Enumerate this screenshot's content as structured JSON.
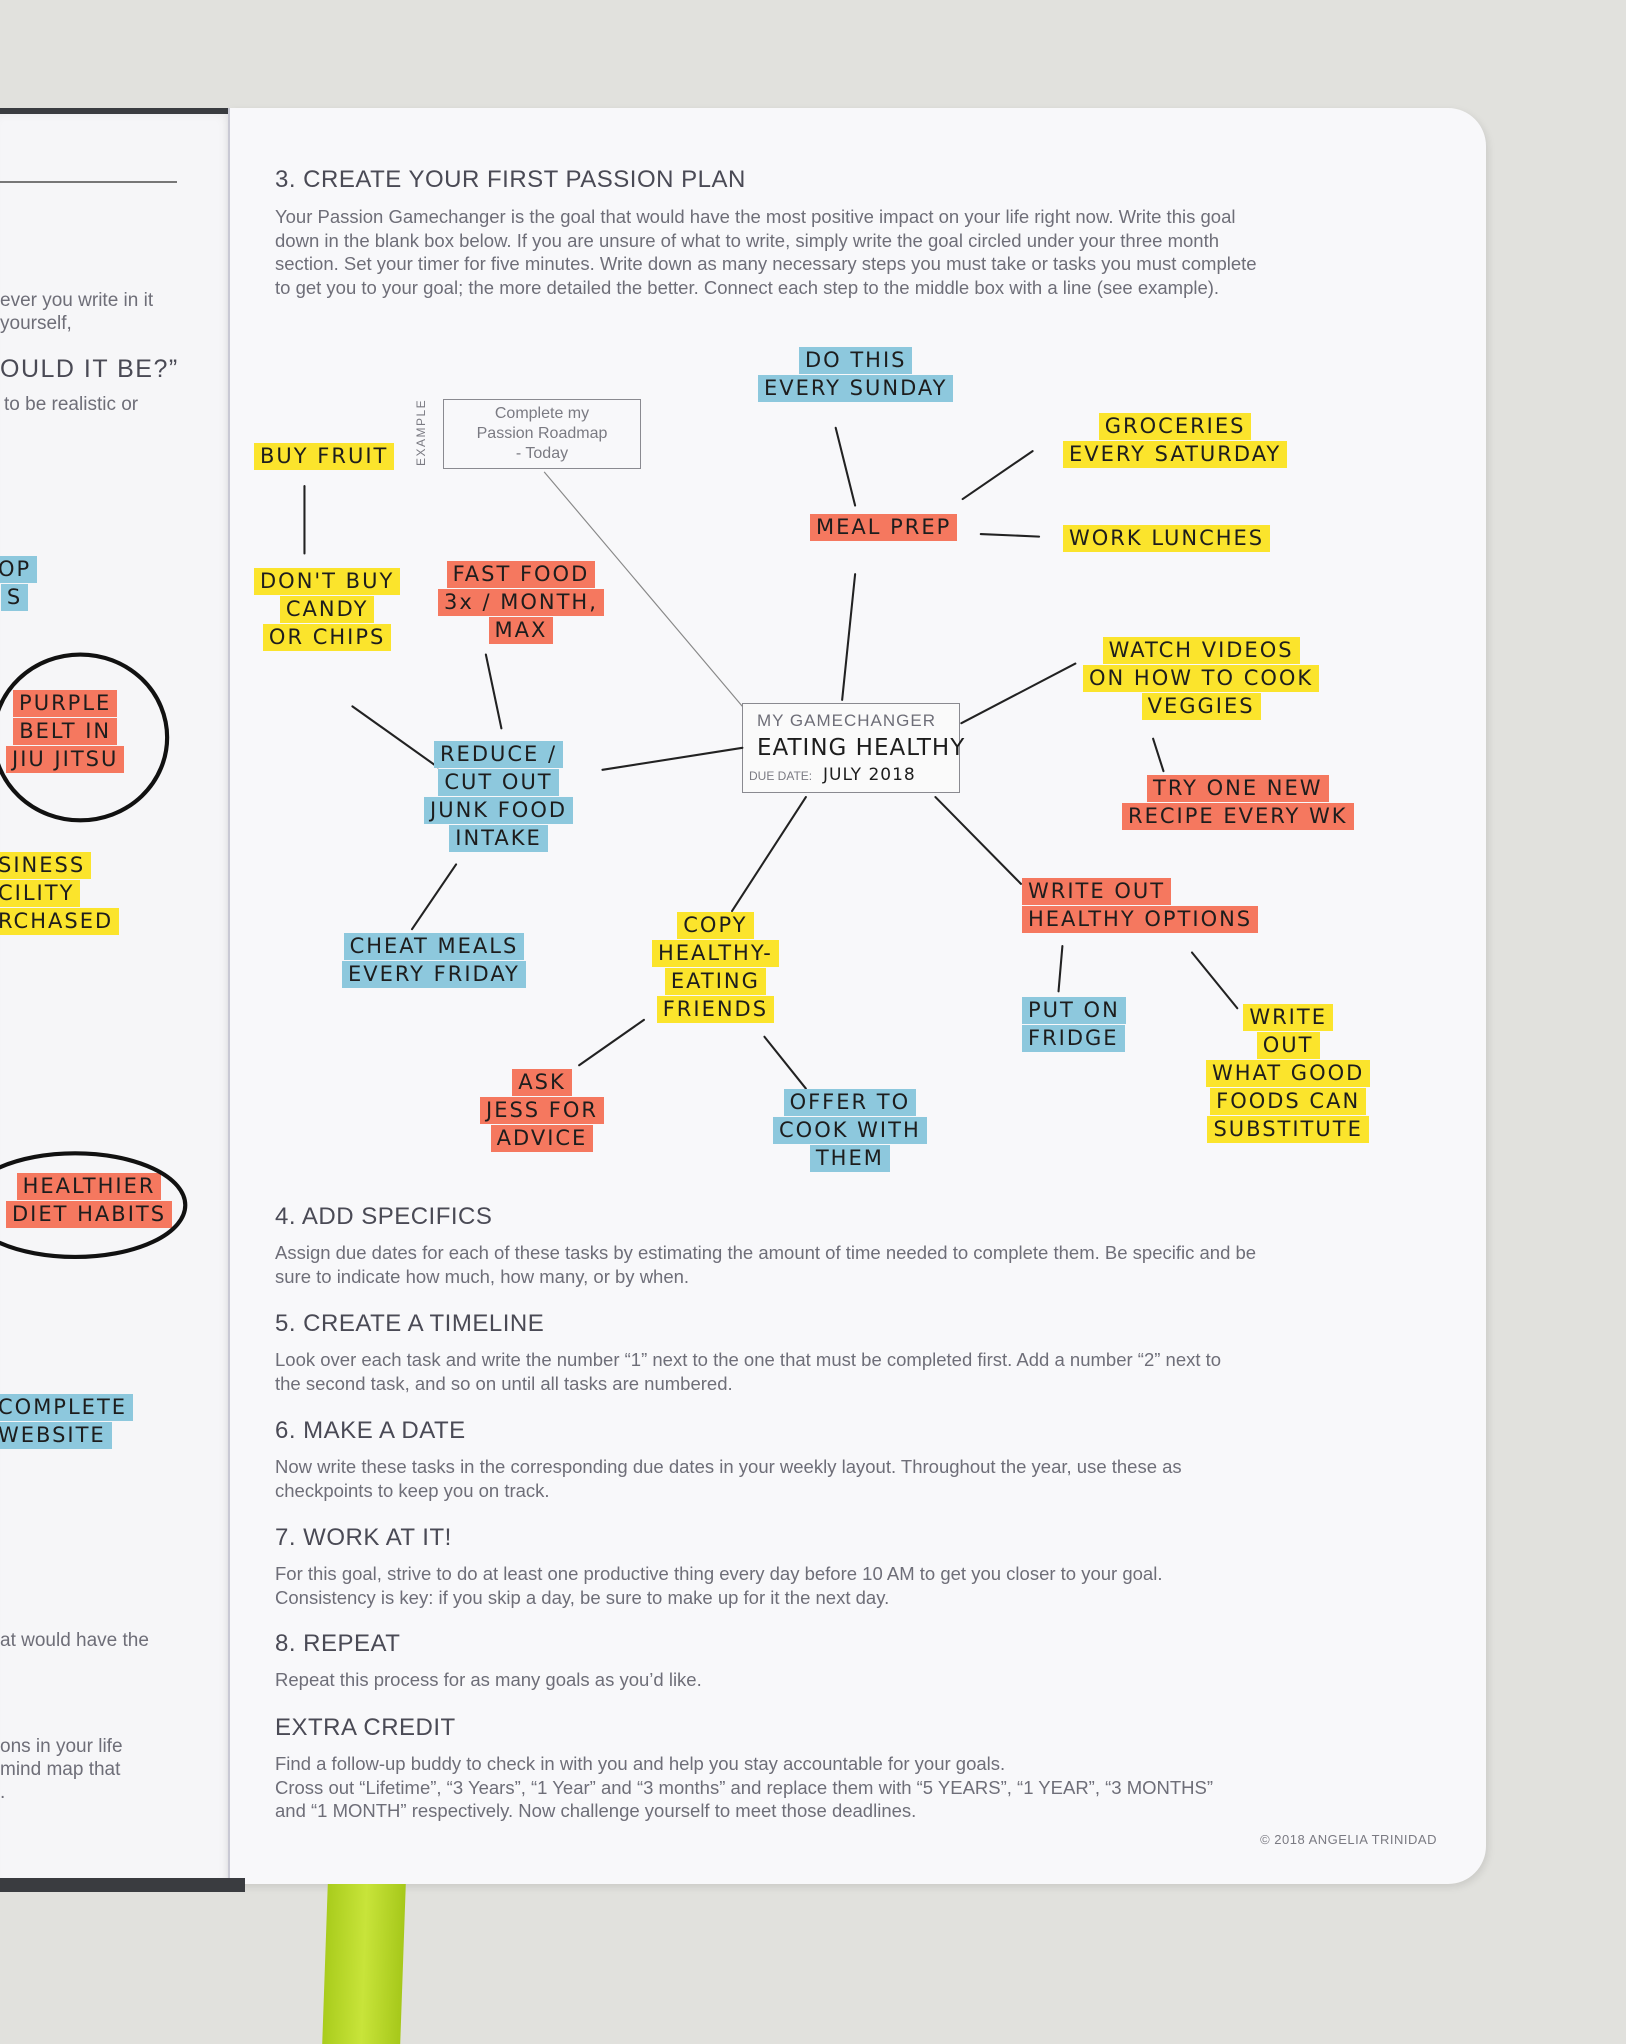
{
  "left_page": {
    "fragments": [
      "ever you write in it",
      "yourself,",
      "OULD IT BE?”",
      "to be realistic or",
      "at would have the",
      "ons in your life",
      "mind map that",
      "."
    ],
    "highlights": [
      {
        "id": "op",
        "color": "blue",
        "lines": [
          "OP",
          "S"
        ]
      },
      {
        "id": "purple",
        "color": "salmon",
        "lines": [
          "PURPLE",
          "BELT IN",
          "JIU JITSU"
        ],
        "circled": true
      },
      {
        "id": "business",
        "color": "yellow",
        "lines": [
          "SINESS",
          "CILITY",
          "RCHASED"
        ]
      },
      {
        "id": "healthier",
        "color": "salmon",
        "lines": [
          "HEALTHIER",
          "DIET HABITS"
        ],
        "circled": true
      },
      {
        "id": "website",
        "color": "blue",
        "lines": [
          "COMPLETE",
          "WEBSITE"
        ]
      }
    ]
  },
  "right_page": {
    "section3": {
      "heading": "3. CREATE YOUR FIRST PASSION PLAN",
      "body": [
        "Your Passion Gamechanger is the goal that would have the most positive impact on your life right now. Write this goal",
        "down in the blank box below. If you are unsure of what to write, simply write the goal circled under your three month",
        "section. Set your timer for five minutes. Write down as many necessary steps you must take or tasks you must complete",
        "to get you to your goal; the more detailed the better. Connect each step to the middle box with a line (see example)."
      ]
    },
    "example_box": {
      "tag": "EXAMPLE",
      "lines": [
        "Complete my",
        "Passion Roadmap",
        "- Today"
      ]
    },
    "center_box": {
      "label": "MY GAMECHANGER",
      "goal": "EATING HEALTHY",
      "due_label": "DUE DATE:",
      "due_value": "JULY 2018"
    },
    "nodes": [
      {
        "id": "sunday",
        "color": "blue",
        "lines": [
          "DO THIS",
          "EVERY SUNDAY"
        ]
      },
      {
        "id": "groceries",
        "color": "yellow",
        "lines": [
          "GROCERIES",
          "EVERY SATURDAY"
        ]
      },
      {
        "id": "buyfruit",
        "color": "yellow",
        "lines": [
          "BUY FRUIT"
        ]
      },
      {
        "id": "mealprep",
        "color": "salmon",
        "lines": [
          "MEAL PREP"
        ]
      },
      {
        "id": "lunches",
        "color": "yellow",
        "lines": [
          "WORK LUNCHES"
        ]
      },
      {
        "id": "candy",
        "color": "yellow",
        "lines": [
          "DON'T BUY",
          "CANDY",
          "OR CHIPS"
        ]
      },
      {
        "id": "fastfood",
        "color": "salmon",
        "lines": [
          "FAST FOOD",
          "3x / MONTH,",
          "MAX"
        ]
      },
      {
        "id": "videos",
        "color": "yellow",
        "lines": [
          "WATCH VIDEOS",
          "ON HOW TO COOK",
          "VEGGIES"
        ]
      },
      {
        "id": "reduce",
        "color": "blue",
        "lines": [
          "REDUCE /",
          "CUT OUT",
          "JUNK FOOD",
          "INTAKE"
        ]
      },
      {
        "id": "recipe",
        "color": "salmon",
        "lines": [
          "TRY ONE NEW",
          "RECIPE EVERY WK"
        ]
      },
      {
        "id": "writeout",
        "color": "salmon",
        "lines": [
          "WRITE OUT",
          "HEALTHY OPTIONS"
        ]
      },
      {
        "id": "copy",
        "color": "yellow",
        "lines": [
          "COPY",
          "HEALTHY-",
          "EATING",
          "FRIENDS"
        ]
      },
      {
        "id": "cheat",
        "color": "blue",
        "lines": [
          "CHEAT MEALS",
          "EVERY FRIDAY"
        ]
      },
      {
        "id": "fridge",
        "color": "blue",
        "lines": [
          "PUT ON",
          "FRIDGE"
        ]
      },
      {
        "id": "substitute",
        "color": "yellow",
        "lines": [
          "WRITE",
          "OUT",
          "WHAT GOOD",
          "FOODS CAN",
          "SUBSTITUTE"
        ]
      },
      {
        "id": "jess",
        "color": "salmon",
        "lines": [
          "ASK",
          "JESS FOR",
          "ADVICE"
        ]
      },
      {
        "id": "offer",
        "color": "blue",
        "lines": [
          "OFFER TO",
          "COOK WITH",
          "THEM"
        ]
      }
    ],
    "sections": [
      {
        "heading": "4. ADD SPECIFICS",
        "body": [
          "Assign due dates for each of these tasks by estimating the amount of time needed to complete them. Be specific and be",
          "sure to indicate how much, how many, or by when."
        ]
      },
      {
        "heading": "5. CREATE A TIMELINE",
        "body": [
          "Look over each task and write the number “1” next to the one that must be completed first. Add a number “2” next to",
          "the second task, and so on until all tasks are numbered."
        ]
      },
      {
        "heading": "6. MAKE A DATE",
        "body": [
          "Now write these tasks in the corresponding due dates in your weekly layout. Throughout the year, use these as",
          "checkpoints to keep you on track."
        ]
      },
      {
        "heading": "7. WORK AT IT!",
        "body": [
          "For this goal, strive to do at least one productive thing every day before 10 AM to get you closer to your goal.",
          "Consistency is key: if you skip a day, be sure to make up for it the next day."
        ]
      },
      {
        "heading": "8. REPEAT",
        "body": [
          "Repeat this process for as many goals as you’d like."
        ]
      },
      {
        "heading": "EXTRA CREDIT",
        "body": [
          "Find a follow-up buddy to check in with you and help you stay accountable for your goals.",
          "Cross out “Lifetime”, “3 Years”, “1 Year” and “3 months” and replace them with “5 YEARS”, “1 YEAR”, “3 MONTHS”",
          "and “1 MONTH” respectively. Now challenge yourself to meet those deadlines."
        ]
      }
    ],
    "copyright": "© 2018 ANGELIA TRINIDAD"
  },
  "colors": {
    "yellow": "#fbe42c",
    "salmon": "#f5785f",
    "blue": "#8dc8dd",
    "ribbon": "#b5d626",
    "cover": "#3a3c40"
  }
}
